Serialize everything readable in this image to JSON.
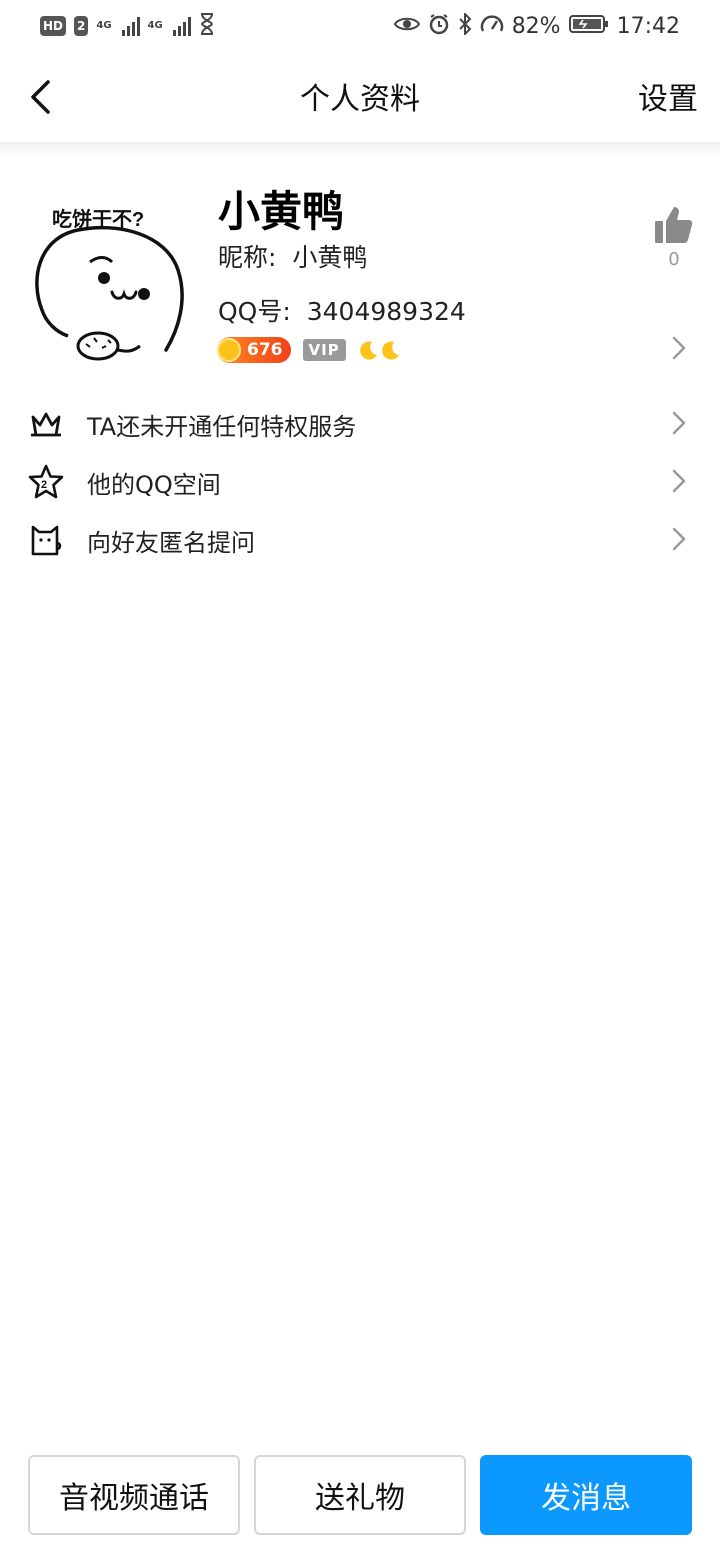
{
  "status_bar": {
    "hd_label": "HD",
    "sim_label": "2",
    "net1": "4G",
    "net2": "4G",
    "battery": "82%",
    "time": "17:42"
  },
  "nav": {
    "title": "个人资料",
    "settings": "设置"
  },
  "profile": {
    "avatar_caption": "吃饼干不?",
    "name": "小黄鸭",
    "nickname_label": "昵称:",
    "nickname": "小黄鸭",
    "qq_label": "QQ号:",
    "qq_number": "3404989324",
    "coin_count": "676",
    "vip_label": "VIP",
    "like_count": "0"
  },
  "menu": [
    {
      "label": "TA还未开通任何特权服务",
      "icon": "crown-icon"
    },
    {
      "label": "他的QQ空间",
      "icon": "star-icon"
    },
    {
      "label": "向好友匿名提问",
      "icon": "cat-icon"
    }
  ],
  "actions": {
    "call": "音视频通话",
    "gift": "送礼物",
    "message": "发消息"
  },
  "colors": {
    "primary": "#0b99ff",
    "coin_gradient_start": "#ff8a1f",
    "coin_gradient_end": "#f2401a"
  }
}
